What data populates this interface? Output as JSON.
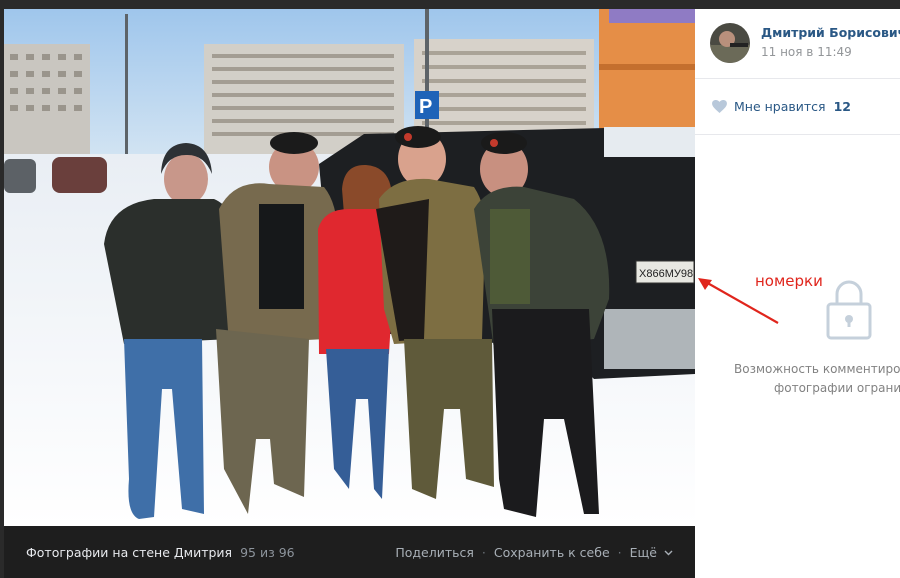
{
  "photo_bar": {
    "album_label": "Фотографии на стене Дмитрия",
    "counter": "95 из 96",
    "share": "Поделиться",
    "save": "Сохранить к себе",
    "more": "Ещё",
    "separator": "·"
  },
  "author": {
    "name": "Дмитрий Борисович",
    "time": "11 ноя в 11:49"
  },
  "likes": {
    "label": "Мне нравится",
    "count": "12"
  },
  "comments_restricted": {
    "line1": "Возможность комментиров",
    "line2": "фотографии огранич"
  },
  "photo": {
    "license_plate": "Х866МУ98"
  },
  "annotation": {
    "text": "номерки",
    "color": "#e0251c"
  },
  "colors": {
    "link": "#2a5885",
    "muted": "#939699",
    "bar_bg": "#1e1e1e"
  },
  "icons": {
    "like": "heart-icon",
    "lock": "lock-icon",
    "more": "chevron-down-icon"
  }
}
